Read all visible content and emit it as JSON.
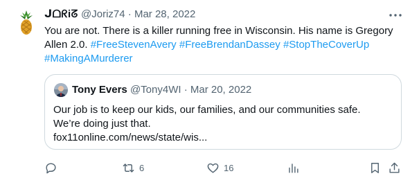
{
  "tweet": {
    "author_name": "ᒍᗝᖇiᘔ",
    "handle": "@Joriz74",
    "separator": "·",
    "date": "Mar 28, 2022",
    "text_plain": "You are not. There is a killer running free in Wisconsin. His name is Gregory Allen 2.0.",
    "hashtags": [
      "#FreeStevenAvery",
      "#FreeBrendanDassey",
      "#StopTheCoverUp",
      "#MakingAMurderer"
    ]
  },
  "quote": {
    "author_name": "Tony Evers",
    "handle": "@Tony4WI",
    "separator": "·",
    "date": "Mar 20, 2022",
    "line1": "Our job is to keep our kids, our families, and our communities safe.",
    "line2": "We’re doing just that.",
    "link": "fox11online.com/news/state/wis..."
  },
  "actions": {
    "reply_count": "",
    "retweet_count": "6",
    "like_count": "16",
    "views_count": ""
  },
  "colors": {
    "accent": "#1d9bf0",
    "muted": "#536471",
    "border": "#cfd9de",
    "text": "#0f1419"
  },
  "icons": [
    "pineapple-avatar",
    "more-icon",
    "reply-icon",
    "retweet-icon",
    "like-icon",
    "views-icon",
    "bookmark-icon",
    "share-icon"
  ]
}
